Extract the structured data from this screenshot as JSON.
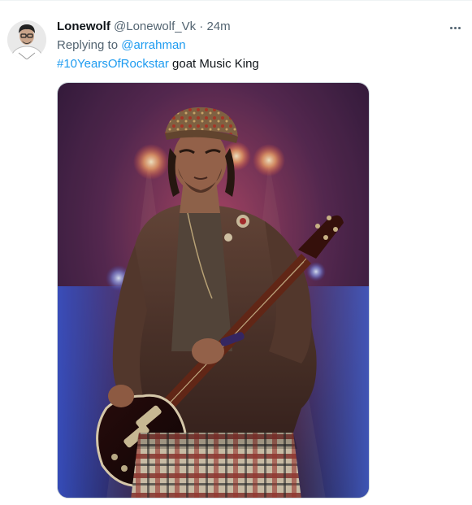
{
  "tweet": {
    "display_name": "Lonewolf",
    "handle": "@Lonewolf_Vk",
    "separator": "·",
    "time": "24m",
    "reply_prefix": "Replying to",
    "reply_to": "@arrahman",
    "hashtag": "#10YearsOfRockstar",
    "text": "goat Music King"
  },
  "icons": {
    "more": "more-horizontal-icon",
    "avatar": "avatar-photo"
  },
  "colors": {
    "link": "#1d9bf0",
    "text": "#0f1419",
    "muted": "#536471"
  }
}
